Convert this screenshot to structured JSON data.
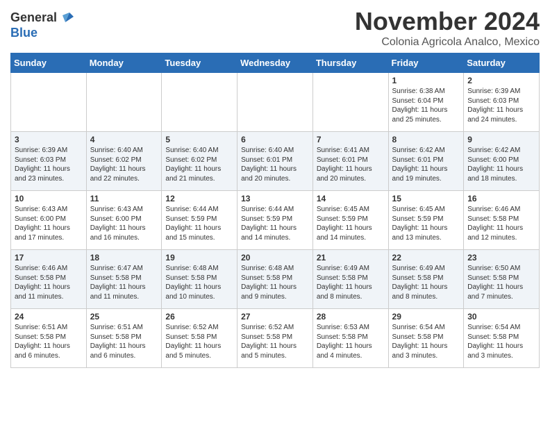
{
  "logo": {
    "general": "General",
    "blue": "Blue"
  },
  "header": {
    "month": "November 2024",
    "location": "Colonia Agricola Analco, Mexico"
  },
  "weekdays": [
    "Sunday",
    "Monday",
    "Tuesday",
    "Wednesday",
    "Thursday",
    "Friday",
    "Saturday"
  ],
  "weeks": [
    [
      {
        "day": "",
        "info": ""
      },
      {
        "day": "",
        "info": ""
      },
      {
        "day": "",
        "info": ""
      },
      {
        "day": "",
        "info": ""
      },
      {
        "day": "",
        "info": ""
      },
      {
        "day": "1",
        "info": "Sunrise: 6:38 AM\nSunset: 6:04 PM\nDaylight: 11 hours and 25 minutes."
      },
      {
        "day": "2",
        "info": "Sunrise: 6:39 AM\nSunset: 6:03 PM\nDaylight: 11 hours and 24 minutes."
      }
    ],
    [
      {
        "day": "3",
        "info": "Sunrise: 6:39 AM\nSunset: 6:03 PM\nDaylight: 11 hours and 23 minutes."
      },
      {
        "day": "4",
        "info": "Sunrise: 6:40 AM\nSunset: 6:02 PM\nDaylight: 11 hours and 22 minutes."
      },
      {
        "day": "5",
        "info": "Sunrise: 6:40 AM\nSunset: 6:02 PM\nDaylight: 11 hours and 21 minutes."
      },
      {
        "day": "6",
        "info": "Sunrise: 6:40 AM\nSunset: 6:01 PM\nDaylight: 11 hours and 20 minutes."
      },
      {
        "day": "7",
        "info": "Sunrise: 6:41 AM\nSunset: 6:01 PM\nDaylight: 11 hours and 20 minutes."
      },
      {
        "day": "8",
        "info": "Sunrise: 6:42 AM\nSunset: 6:01 PM\nDaylight: 11 hours and 19 minutes."
      },
      {
        "day": "9",
        "info": "Sunrise: 6:42 AM\nSunset: 6:00 PM\nDaylight: 11 hours and 18 minutes."
      }
    ],
    [
      {
        "day": "10",
        "info": "Sunrise: 6:43 AM\nSunset: 6:00 PM\nDaylight: 11 hours and 17 minutes."
      },
      {
        "day": "11",
        "info": "Sunrise: 6:43 AM\nSunset: 6:00 PM\nDaylight: 11 hours and 16 minutes."
      },
      {
        "day": "12",
        "info": "Sunrise: 6:44 AM\nSunset: 5:59 PM\nDaylight: 11 hours and 15 minutes."
      },
      {
        "day": "13",
        "info": "Sunrise: 6:44 AM\nSunset: 5:59 PM\nDaylight: 11 hours and 14 minutes."
      },
      {
        "day": "14",
        "info": "Sunrise: 6:45 AM\nSunset: 5:59 PM\nDaylight: 11 hours and 14 minutes."
      },
      {
        "day": "15",
        "info": "Sunrise: 6:45 AM\nSunset: 5:59 PM\nDaylight: 11 hours and 13 minutes."
      },
      {
        "day": "16",
        "info": "Sunrise: 6:46 AM\nSunset: 5:58 PM\nDaylight: 11 hours and 12 minutes."
      }
    ],
    [
      {
        "day": "17",
        "info": "Sunrise: 6:46 AM\nSunset: 5:58 PM\nDaylight: 11 hours and 11 minutes."
      },
      {
        "day": "18",
        "info": "Sunrise: 6:47 AM\nSunset: 5:58 PM\nDaylight: 11 hours and 11 minutes."
      },
      {
        "day": "19",
        "info": "Sunrise: 6:48 AM\nSunset: 5:58 PM\nDaylight: 11 hours and 10 minutes."
      },
      {
        "day": "20",
        "info": "Sunrise: 6:48 AM\nSunset: 5:58 PM\nDaylight: 11 hours and 9 minutes."
      },
      {
        "day": "21",
        "info": "Sunrise: 6:49 AM\nSunset: 5:58 PM\nDaylight: 11 hours and 8 minutes."
      },
      {
        "day": "22",
        "info": "Sunrise: 6:49 AM\nSunset: 5:58 PM\nDaylight: 11 hours and 8 minutes."
      },
      {
        "day": "23",
        "info": "Sunrise: 6:50 AM\nSunset: 5:58 PM\nDaylight: 11 hours and 7 minutes."
      }
    ],
    [
      {
        "day": "24",
        "info": "Sunrise: 6:51 AM\nSunset: 5:58 PM\nDaylight: 11 hours and 6 minutes."
      },
      {
        "day": "25",
        "info": "Sunrise: 6:51 AM\nSunset: 5:58 PM\nDaylight: 11 hours and 6 minutes."
      },
      {
        "day": "26",
        "info": "Sunrise: 6:52 AM\nSunset: 5:58 PM\nDaylight: 11 hours and 5 minutes."
      },
      {
        "day": "27",
        "info": "Sunrise: 6:52 AM\nSunset: 5:58 PM\nDaylight: 11 hours and 5 minutes."
      },
      {
        "day": "28",
        "info": "Sunrise: 6:53 AM\nSunset: 5:58 PM\nDaylight: 11 hours and 4 minutes."
      },
      {
        "day": "29",
        "info": "Sunrise: 6:54 AM\nSunset: 5:58 PM\nDaylight: 11 hours and 3 minutes."
      },
      {
        "day": "30",
        "info": "Sunrise: 6:54 AM\nSunset: 5:58 PM\nDaylight: 11 hours and 3 minutes."
      }
    ]
  ]
}
